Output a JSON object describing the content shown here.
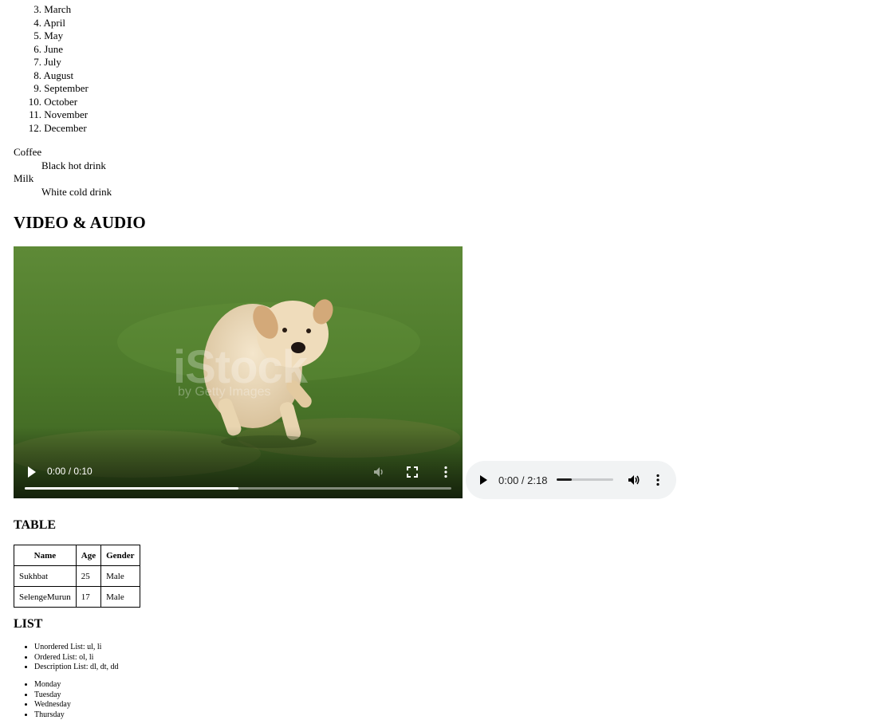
{
  "months": [
    {
      "num": "3.",
      "name": "March"
    },
    {
      "num": "4.",
      "name": "April"
    },
    {
      "num": "5.",
      "name": "May"
    },
    {
      "num": "6.",
      "name": "June"
    },
    {
      "num": "7.",
      "name": "July"
    },
    {
      "num": "8.",
      "name": "August"
    },
    {
      "num": "9.",
      "name": "September"
    },
    {
      "num": "10.",
      "name": "October"
    },
    {
      "num": "11.",
      "name": "November"
    },
    {
      "num": "12.",
      "name": "December"
    }
  ],
  "drinks": [
    {
      "term": "Coffee",
      "desc": "Black hot drink"
    },
    {
      "term": "Milk",
      "desc": "White cold drink"
    }
  ],
  "video_audio_heading": "VIDEO & AUDIO",
  "video": {
    "time": "0:00 / 0:10",
    "progress_fraction": 0.5,
    "watermark": "iStock",
    "watermark_sub": "by Getty Images"
  },
  "audio": {
    "time": "0:00 / 2:18",
    "volume_fraction": 0.27
  },
  "table_heading": "TABLE",
  "table": {
    "headers": [
      "Name",
      "Age",
      "Gender"
    ],
    "rows": [
      [
        "Sukhbat",
        "25",
        "Male"
      ],
      [
        "SelengeMurun",
        "17",
        "Male"
      ]
    ]
  },
  "list_heading": "LIST",
  "list_kinds": [
    "Unordered List: ul, li",
    "Ordered List: ol, li",
    "Description List: dl, dt, dd"
  ],
  "days": [
    "Monday",
    "Tuesday",
    "Wednesday",
    "Thursday"
  ]
}
